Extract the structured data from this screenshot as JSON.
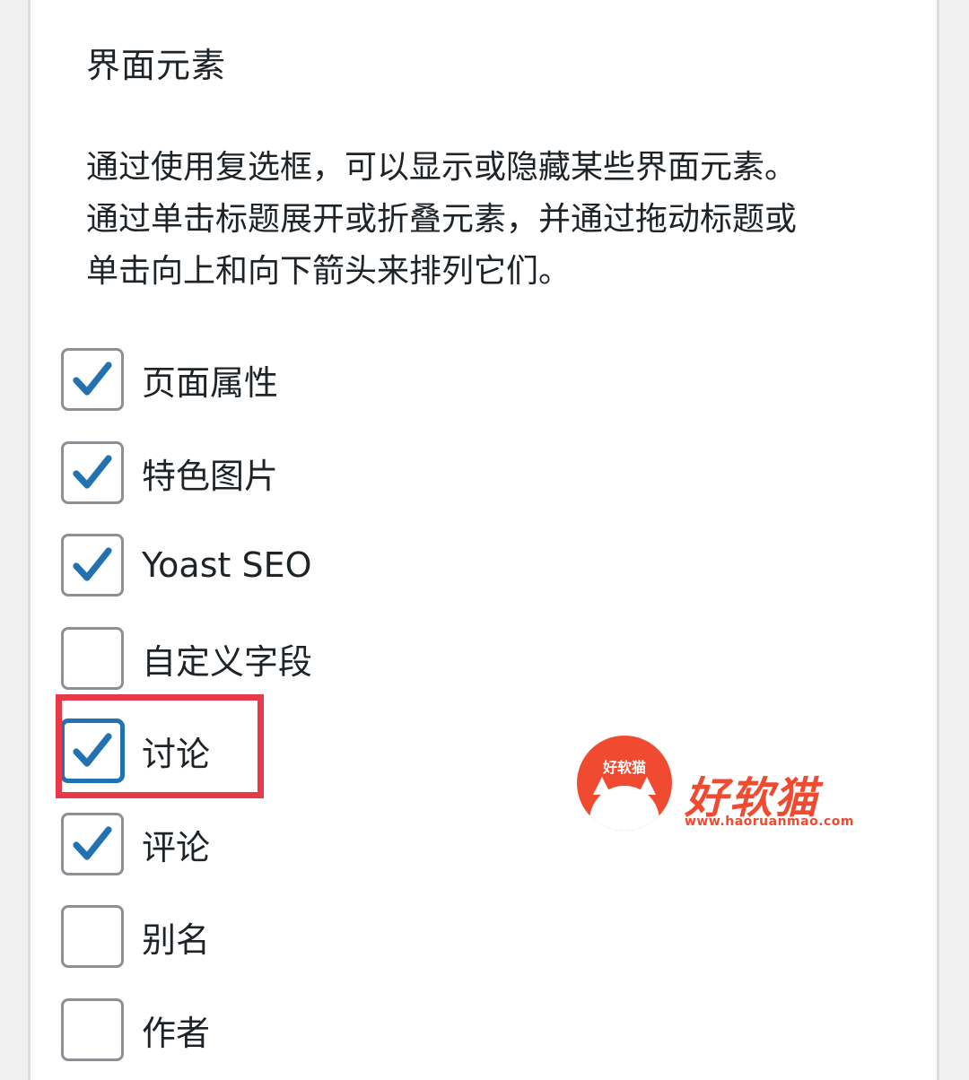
{
  "section": {
    "title": "界面元素",
    "description_lines": [
      "通过使用复选框，可以显示或隐藏某些界面元素。",
      "通过单击标题展开或折叠元素，并通过拖动标题或",
      "单击向上和向下箭头来排列它们。"
    ]
  },
  "options": [
    {
      "label": "页面属性",
      "checked": true
    },
    {
      "label": "特色图片",
      "checked": true
    },
    {
      "label": "Yoast SEO",
      "checked": true
    },
    {
      "label": "自定义字段",
      "checked": false
    },
    {
      "label": "讨论",
      "checked": true,
      "focused": true
    },
    {
      "label": "评论",
      "checked": true
    },
    {
      "label": "别名",
      "checked": false
    },
    {
      "label": "作者",
      "checked": false
    }
  ],
  "colors": {
    "check": "#2271b1",
    "highlight": "#e8394a",
    "watermark": "#f04a30"
  },
  "watermark": {
    "logo_text": "好软猫",
    "brand": "好软猫",
    "url": "www.haoruanmao.com"
  }
}
